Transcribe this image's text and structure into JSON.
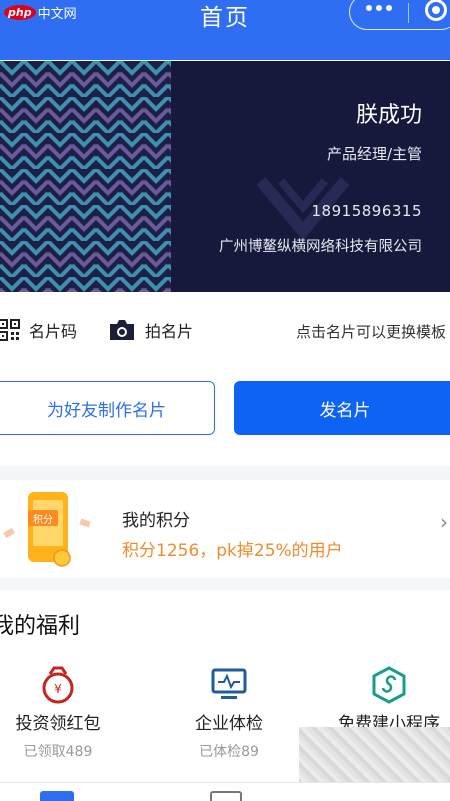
{
  "watermark": {
    "badge": "php",
    "text": "中文网"
  },
  "nav": {
    "title": "首页"
  },
  "card": {
    "name": "朕成功",
    "title": "产品经理/主管",
    "phone": "18915896315",
    "company": "广州博鳌纵横网络科技有限公司"
  },
  "tools": {
    "qr_label": "名片码",
    "camera_label": "拍名片",
    "tip": "点击名片可以更换模板"
  },
  "buttons": {
    "make_for_friend": "为好友制作名片",
    "send_card": "发名片"
  },
  "points": {
    "badge": "积分",
    "title": "我的积分",
    "subtitle": "积分1256，pk掉25%的用户"
  },
  "welfare": {
    "title": "我的福利",
    "items": [
      {
        "name": "投资领红包",
        "sub": "已领取489",
        "icon": "red-envelope-icon"
      },
      {
        "name": "企业体检",
        "sub": "已体检89",
        "icon": "monitor-icon"
      },
      {
        "name": "免费建小程序",
        "sub": "",
        "icon": "mini-program-icon"
      }
    ]
  },
  "colors": {
    "primary": "#2f6ef2",
    "card_bg": "#16193b",
    "accent_orange": "#f08c2c"
  }
}
